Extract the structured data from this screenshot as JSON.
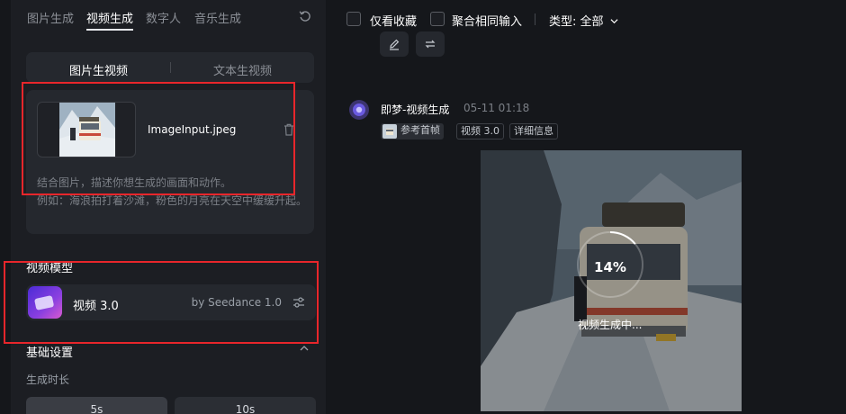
{
  "tabs": [
    {
      "label": "图片生成",
      "active": false
    },
    {
      "label": "视频生成",
      "active": true
    },
    {
      "label": "数字人",
      "active": false
    },
    {
      "label": "音乐生成",
      "active": false
    }
  ],
  "mode_switch": [
    {
      "label": "图片生视频",
      "active": true
    },
    {
      "label": "文本生视频",
      "active": false
    }
  ],
  "upload": {
    "filename": "ImageInput.jpeg",
    "hint_line1": "结合图片，描述你想生成的画面和动作。",
    "hint_line2": "例如：海浪拍打着沙滩，粉色的月亮在天空中缓缓升起。"
  },
  "model_section": {
    "title": "视频模型",
    "model_name": "视频 3.0",
    "model_by": "by Seedance 1.0"
  },
  "basic_settings": {
    "title": "基础设置",
    "duration_label": "生成时长",
    "durations": [
      "5s",
      "10s"
    ]
  },
  "filters": {
    "only_favorites": "仅看收藏",
    "merge_same": "聚合相同输入",
    "type_label": "类型: 全部"
  },
  "generation": {
    "title": "即梦-视频生成",
    "time": "05-11  01:18",
    "tags": [
      "参考首帧",
      "视频 3.0",
      "详细信息"
    ],
    "progress_percent": 14,
    "progress_text": "14%",
    "status": "视频生成中..."
  },
  "colors": {
    "highlight_box": "#e8262b",
    "panel_bg": "#1c1e23",
    "page_bg": "#15171b"
  },
  "icons": [
    "refresh-icon",
    "trash-icon",
    "tune-icon",
    "chevron-up-icon",
    "chevron-down-icon",
    "edit-icon",
    "swap-icon"
  ]
}
